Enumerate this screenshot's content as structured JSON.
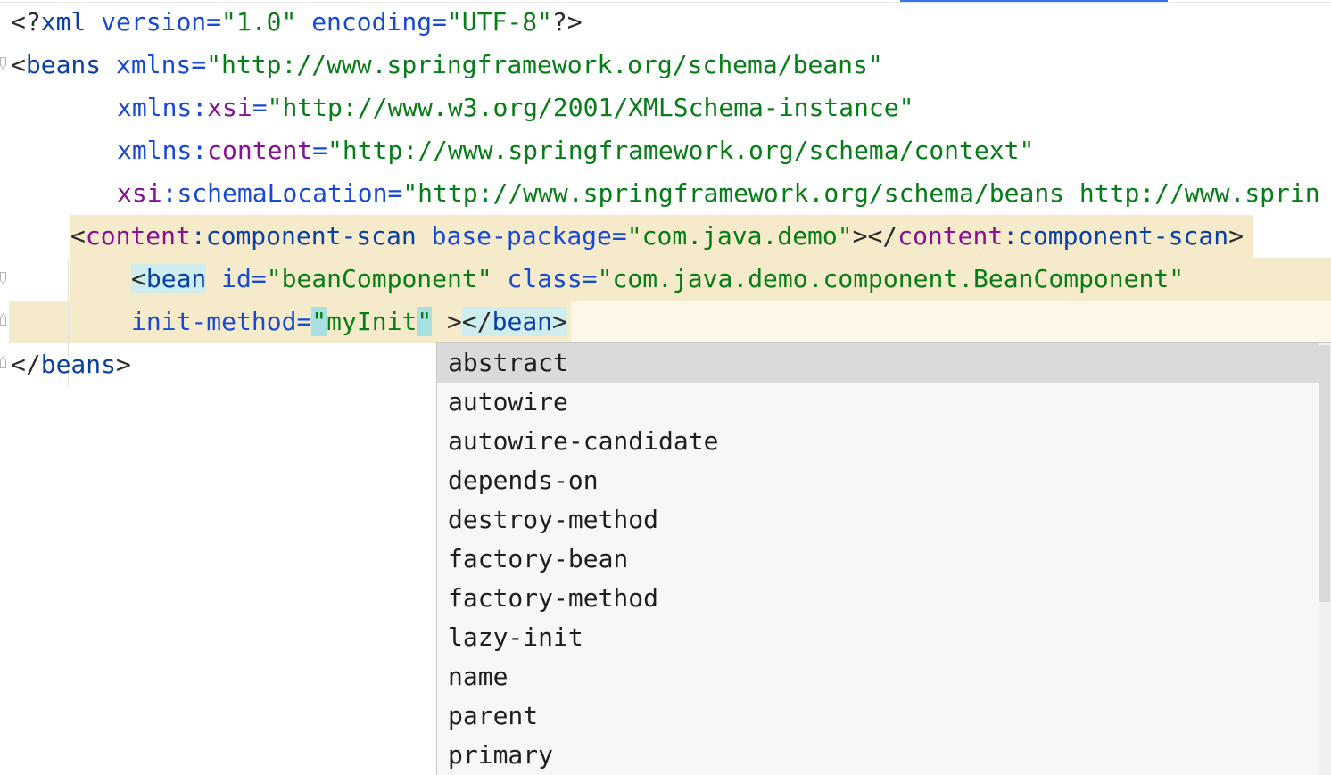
{
  "editor": {
    "line1": {
      "open": "<?",
      "name": "xml",
      "attr1": "version",
      "val1": "\"1.0\"",
      "attr2": "encoding",
      "val2": "\"UTF-8\"",
      "close": "?>"
    },
    "line2": {
      "open": "<",
      "tag": "beans",
      "attr": "xmlns",
      "val": "\"http://www.springframework.org/schema/beans\""
    },
    "line3": {
      "attr": "xmlns",
      "ns": "xsi",
      "val": "\"http://www.w3.org/2001/XMLSchema-instance\""
    },
    "line4": {
      "attr": "xmlns",
      "ns": "content",
      "val": "\"http://www.springframework.org/schema/context\""
    },
    "line5": {
      "ns": "xsi",
      "attr": "schemaLocation",
      "val": "\"http://www.springframework.org/schema/beans http://www.sprin"
    },
    "line6": {
      "ns": "content",
      "tag": "component-scan",
      "attr": "base-package",
      "val": "\"com.java.demo\"",
      "close_ns": "content",
      "close_tag": "component-scan"
    },
    "line7": {
      "tag": "bean",
      "attr1": "id",
      "val1": "\"beanComponent\"",
      "attr2": "class",
      "val2": "\"com.java.demo.component.BeanComponent\""
    },
    "line8": {
      "attr": "init-method",
      "val": "myInit",
      "close_tag": "bean"
    },
    "line9": {
      "tag": "beans"
    },
    "colon": ":",
    "eq": "=",
    "quote": "\"",
    "lt": "<",
    "gt": ">",
    "lt_slash": "</"
  },
  "completion": {
    "items": [
      "abstract",
      "autowire",
      "autowire-candidate",
      "depends-on",
      "destroy-method",
      "factory-bean",
      "factory-method",
      "lazy-init",
      "name",
      "parent",
      "primary"
    ],
    "selected_index": 0
  },
  "icons": {
    "fold": "fold-marker-icon"
  }
}
